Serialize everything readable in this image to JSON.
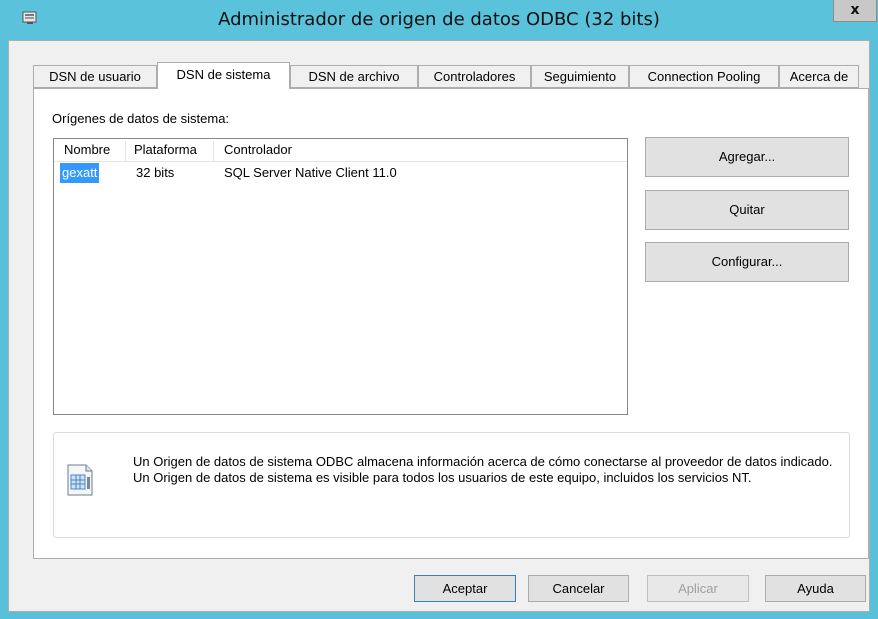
{
  "window": {
    "title": "Administrador de origen de datos ODBC (32 bits)",
    "close_label": "x"
  },
  "tabs": [
    {
      "label": "DSN de usuario",
      "active": false
    },
    {
      "label": "DSN de sistema",
      "active": true
    },
    {
      "label": "DSN de archivo",
      "active": false
    },
    {
      "label": "Controladores",
      "active": false
    },
    {
      "label": "Seguimiento",
      "active": false
    },
    {
      "label": "Connection Pooling",
      "active": false
    },
    {
      "label": "Acerca de",
      "active": false
    }
  ],
  "main": {
    "section_label": "Orígenes de datos de sistema:",
    "columns": [
      "Nombre",
      "Plataforma",
      "Controlador"
    ],
    "rows": [
      {
        "name": "gexatt",
        "platform": "32 bits",
        "driver": "SQL Server Native Client 11.0",
        "selected": true
      }
    ],
    "buttons": {
      "add": "Agregar...",
      "remove": "Quitar",
      "configure": "Configurar..."
    },
    "info_text": "Un Origen de datos de sistema ODBC almacena información acerca de cómo conectarse al proveedor de datos indicado. Un Origen de datos de sistema es visible para todos los usuarios de este equipo, incluidos los servicios NT."
  },
  "footer": {
    "ok": "Aceptar",
    "cancel": "Cancelar",
    "apply": "Aplicar",
    "help": "Ayuda"
  },
  "colors": {
    "title_bar": "#5ac2db",
    "selection": "#3399ff"
  },
  "icons": {
    "window": "odbc-datasource-icon",
    "info": "database-document-icon"
  }
}
